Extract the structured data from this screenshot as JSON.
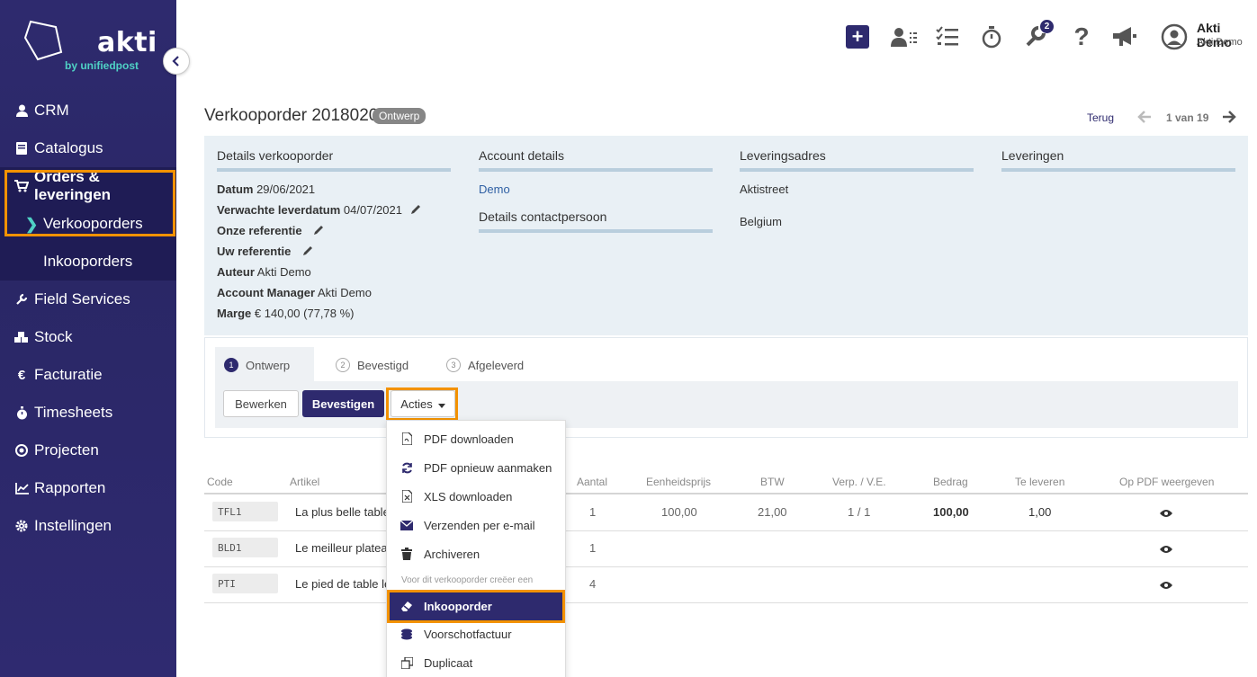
{
  "sidebar": {
    "brand": "akti",
    "brand_sub": "by unifiedpost",
    "items": [
      {
        "label": "CRM",
        "icon": "user-icon"
      },
      {
        "label": "Catalogus",
        "icon": "book-icon"
      },
      {
        "label": "Orders & leveringen",
        "icon": "cart-icon"
      },
      {
        "label": "Field Services",
        "icon": "wrench-icon"
      },
      {
        "label": "Stock",
        "icon": "cubes-icon"
      },
      {
        "label": "Facturatie",
        "icon": "euro-icon"
      },
      {
        "label": "Timesheets",
        "icon": "stopwatch-icon"
      },
      {
        "label": "Projecten",
        "icon": "target-icon"
      },
      {
        "label": "Rapporten",
        "icon": "chart-icon"
      },
      {
        "label": "Instellingen",
        "icon": "gear-icon"
      }
    ],
    "subitems": [
      {
        "label": "Verkooporders"
      },
      {
        "label": "Inkooporders"
      }
    ]
  },
  "header": {
    "badge_count": "2",
    "user_name": "Akti Demo",
    "user_company": "Akti Demo"
  },
  "page": {
    "title": "Verkooporder 2018020",
    "status": "Ontwerp",
    "back": "Terug",
    "pager": "1 van 19"
  },
  "details": {
    "col1_title": "Details verkooporder",
    "fields": [
      {
        "label": "Datum",
        "value": "29/06/2021"
      },
      {
        "label": "Verwachte leverdatum",
        "value": "04/07/2021"
      },
      {
        "label": "Onze referentie",
        "value": ""
      },
      {
        "label": "Uw referentie",
        "value": ""
      },
      {
        "label": "Auteur",
        "value": "Akti Demo"
      },
      {
        "label": "Account Manager",
        "value": "Akti Demo"
      },
      {
        "label": "Marge",
        "value": "€ 140,00 (77,78 %)"
      }
    ],
    "col2_title": "Account details",
    "account": "Demo",
    "contact_title": "Details contactpersoon",
    "col3_title": "Leveringsadres",
    "address_line1": "Aktistreet",
    "address_line2": "Belgium",
    "col4_title": "Leveringen"
  },
  "workflow": {
    "steps": [
      {
        "num": "1",
        "label": "Ontwerp"
      },
      {
        "num": "2",
        "label": "Bevestigd"
      },
      {
        "num": "3",
        "label": "Afgeleverd"
      }
    ],
    "buttons": {
      "edit": "Bewerken",
      "confirm": "Bevestigen",
      "actions": "Acties"
    }
  },
  "dropdown": {
    "items": [
      {
        "label": "PDF downloaden",
        "icon": "pdf-icon"
      },
      {
        "label": "PDF opnieuw aanmaken",
        "icon": "refresh-icon"
      },
      {
        "label": "XLS downloaden",
        "icon": "xls-icon"
      },
      {
        "label": "Verzenden per e-mail",
        "icon": "envelope-icon"
      },
      {
        "label": "Archiveren",
        "icon": "trash-icon"
      }
    ],
    "section_header": "Voor dit verkooporder creëer een",
    "create_items": [
      {
        "label": "Inkooporder",
        "icon": "eraser-icon"
      },
      {
        "label": "Voorschotfactuur",
        "icon": "coins-icon"
      },
      {
        "label": "Duplicaat",
        "icon": "copy-icon"
      }
    ]
  },
  "table": {
    "columns": [
      "Code",
      "Artikel",
      "Aantal",
      "Eenheidsprijs",
      "BTW",
      "Verp. / V.E.",
      "Bedrag",
      "Te leveren",
      "Op PDF weergeven"
    ],
    "rows": [
      {
        "code": "TFL1",
        "article": "La plus belle table",
        "qty": "1",
        "unit_price": "100,00",
        "vat": "21,00",
        "pack": "1 / 1",
        "amount": "100,00",
        "to_deliver": "1,00"
      },
      {
        "code": "BLD1",
        "article": "Le meilleur platea",
        "qty": "1",
        "unit_price": "",
        "vat": "",
        "pack": "",
        "amount": "",
        "to_deliver": ""
      },
      {
        "code": "PTI",
        "article": "Le pied de table le",
        "qty": "4",
        "unit_price": "",
        "vat": "",
        "pack": "",
        "amount": "",
        "to_deliver": ""
      }
    ]
  },
  "colors": {
    "brand": "#2e2a6e",
    "accent": "#4fd1c5",
    "highlight": "#f39200"
  }
}
